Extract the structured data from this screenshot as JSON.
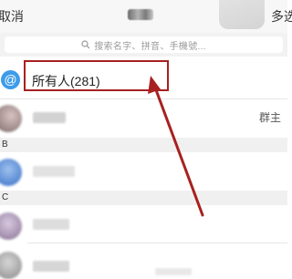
{
  "header": {
    "cancel_label": "取消",
    "multi_select_label": "多选"
  },
  "search": {
    "placeholder": "搜索名字、拼音、手機號..."
  },
  "everyone": {
    "icon_glyph": "@",
    "label": "所有人(281)"
  },
  "group_row": {
    "tag": "群主"
  },
  "sections": [
    {
      "letter": "B"
    },
    {
      "letter": "C"
    }
  ],
  "colors": {
    "accent_blue": "#3d9be9",
    "annotation_red": "#a82020",
    "header_bg": "#f7f7f7",
    "section_bg": "#f0f0f0"
  }
}
